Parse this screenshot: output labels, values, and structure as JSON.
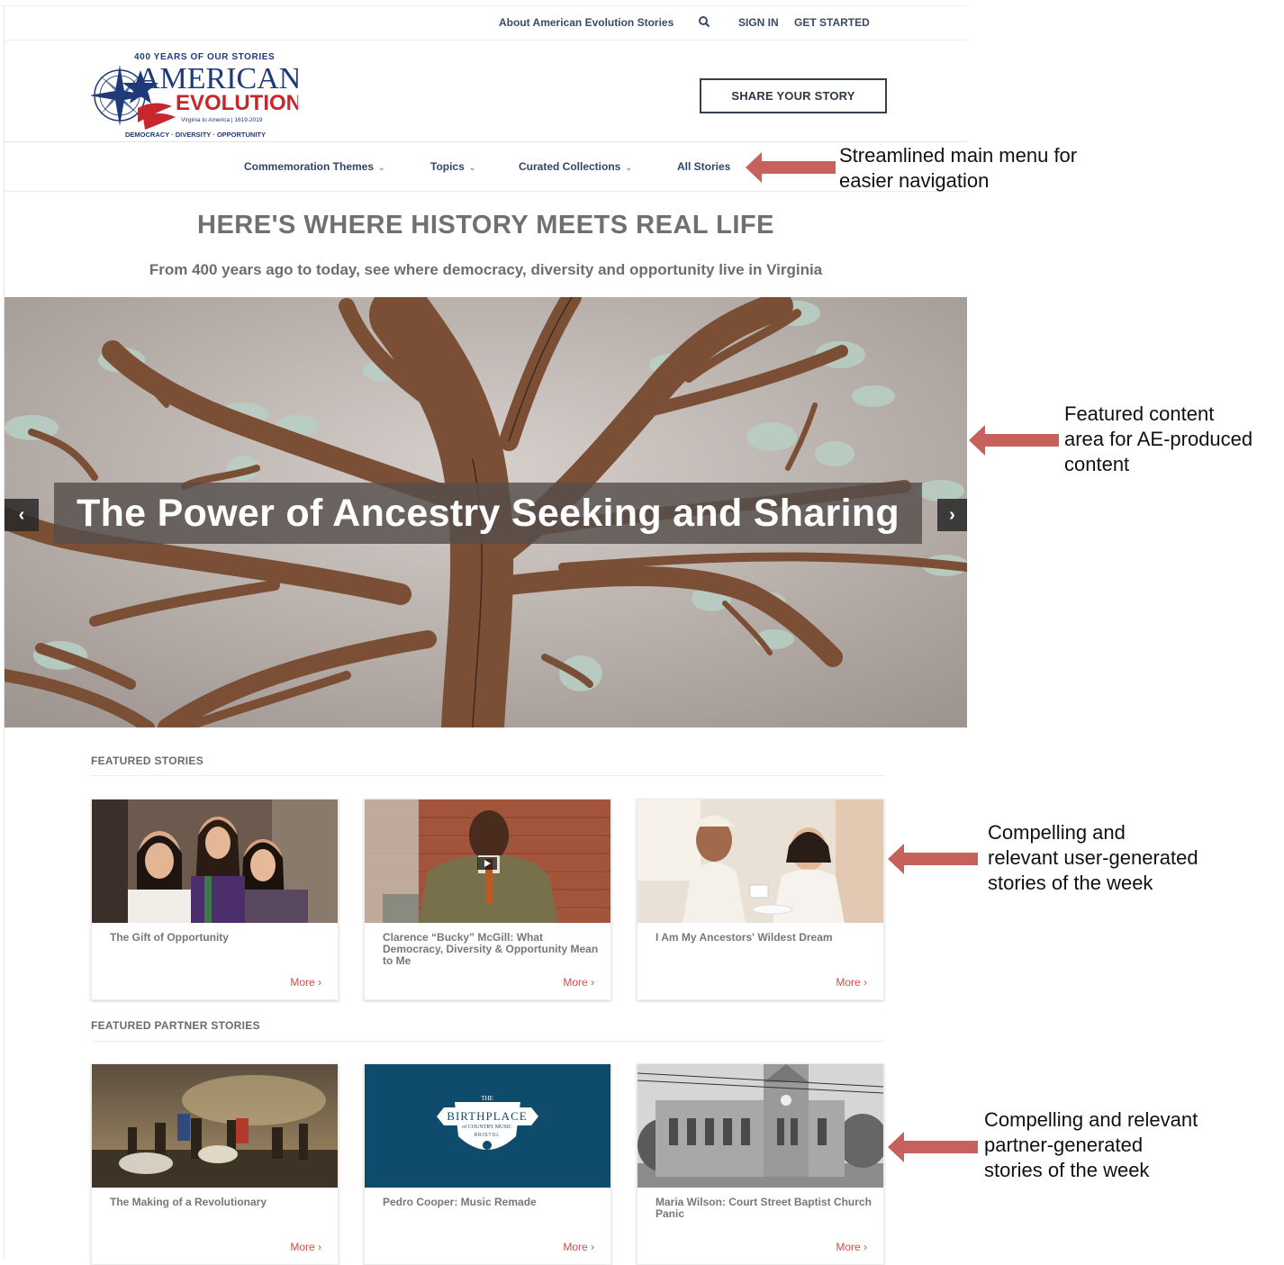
{
  "utility_nav": {
    "about": "About American Evolution Stories",
    "sign_in": "SIGN IN",
    "get_started": "GET STARTED",
    "search_icon": "search-icon"
  },
  "logo": {
    "top_line": "400 YEARS OF OUR STORIES",
    "word1": "AMERICAN",
    "word2": "EVOLUTION",
    "tagline": "Virginia to America | 1619-2019",
    "bottom_line": "DEMOCRACY · DIVERSITY · OPPORTUNITY"
  },
  "share_button": "SHARE YOUR STORY",
  "main_nav": [
    {
      "label": "Commemoration Themes",
      "dropdown": true
    },
    {
      "label": "Topics",
      "dropdown": true
    },
    {
      "label": "Curated Collections",
      "dropdown": true
    },
    {
      "label": "All Stories",
      "dropdown": false
    }
  ],
  "hero": {
    "headline": "HERE'S WHERE HISTORY MEETS REAL LIFE",
    "subhead": "From 400 years ago to today, see where democracy, diversity and opportunity live in Virginia",
    "slide_title": "The Power of Ancestry Seeking and Sharing",
    "prev_label": "‹",
    "next_label": "›"
  },
  "featured_stories": {
    "heading": "FEATURED STORIES",
    "cards": [
      {
        "title": "The Gift of Opportunity",
        "more": "More ›"
      },
      {
        "title": "Clarence “Bucky” McGill: What Democracy, Diversity & Opportunity Mean to Me",
        "more": "More ›"
      },
      {
        "title": "I Am My Ancestors' Wildest Dream",
        "more": "More ›"
      }
    ]
  },
  "partner_stories": {
    "heading": "FEATURED PARTNER STORIES",
    "cards": [
      {
        "title": "The Making of a Revolutionary",
        "more": "More ›"
      },
      {
        "title": "Pedro Cooper: Music Remade",
        "more": "More ›",
        "logo_line1": "THE",
        "logo_line2": "BIRTHPLACE",
        "logo_line3": "of COUNTRY MUSIC",
        "logo_line4": "BRISTOL"
      },
      {
        "title": "Maria Wilson: Court Street Baptist Church Panic",
        "more": "More ›"
      }
    ]
  },
  "annotations": {
    "nav_note_line1": "Streamlined main menu for",
    "nav_note_line2": "easier navigation",
    "hero_note_line1": "Featured content",
    "hero_note_line2": "area for AE-produced",
    "hero_note_line3": "content",
    "user_note_line1": "Compelling and",
    "user_note_line2": "relevant user-generated",
    "user_note_line3": "stories of the week",
    "partner_note_line1": "Compelling and relevant",
    "partner_note_line2": "partner-generated",
    "partner_note_line3": "stories of the week"
  },
  "colors": {
    "nav_text": "#2f4569",
    "more_link": "#d24d45",
    "callout_arrow": "#c8605c",
    "logo_blue": "#1f3a78",
    "logo_red": "#c8262c"
  }
}
